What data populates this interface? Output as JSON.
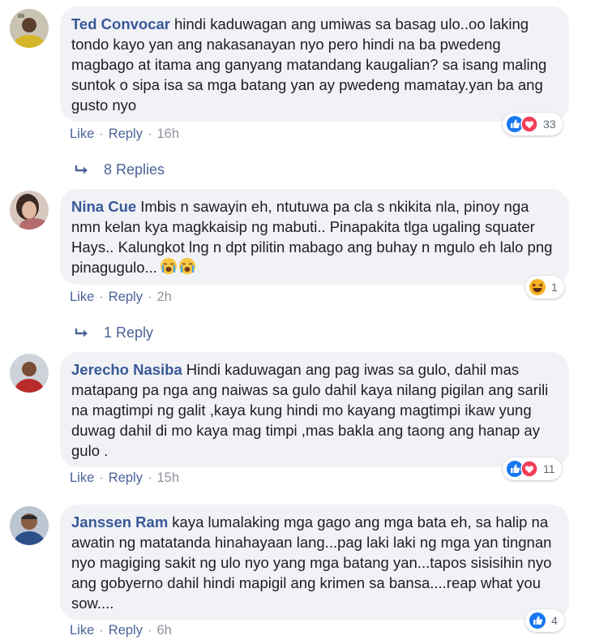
{
  "ui": {
    "like": "Like",
    "reply": "Reply",
    "dot": "·"
  },
  "comments": [
    {
      "author": "Ted Convocar",
      "text": "hindi kaduwagan ang umiwas sa basag ulo..oo laking tondo kayo yan ang nakasanayan nyo pero hindi na ba pwedeng magbago at itama ang ganyang matandang kaugalian? sa isang maling suntok o sipa isa sa mga batang yan ay pwedeng mamatay.yan ba ang gusto nyo",
      "time": "16h",
      "reaction_icons": [
        "like-reaction-icon",
        "love-reaction-icon"
      ],
      "reaction_count": "33",
      "replies": "8 Replies"
    },
    {
      "author": "Nina Cue",
      "text": "Imbis n sawayin eh, ntutuwa pa cla s nkikita nla, pinoy nga nmn kelan kya magkkaisip ng mabuti.. Pinapakita tlga ugaling squater Hays.. Kalungkot lng n dpt pilitin mabago ang buhay n mgulo eh lalo png pinagugulo...",
      "time": "2h",
      "reaction_icons": [
        "haha-reaction-icon"
      ],
      "reaction_count": "1",
      "replies": "1 Reply"
    },
    {
      "author": "Jerecho Nasiba",
      "text": "Hindi kaduwagan ang pag iwas sa gulo, dahil mas matapang pa nga ang naiwas sa gulo dahil kaya nilang pigilan ang sarili na magtimpi ng galit ,kaya kung hindi mo kayang magtimpi ikaw yung duwag dahil di mo kaya mag timpi ,mas bakla ang taong ang hanap ay gulo .",
      "time": "15h",
      "reaction_icons": [
        "like-reaction-icon",
        "love-reaction-icon"
      ],
      "reaction_count": "11"
    },
    {
      "author": "Janssen Ram",
      "text": "kaya lumalaking mga gago ang mga bata eh, sa halip na awatin ng matatanda hinahayaan lang...pag laki laki ng mga yan tingnan nyo magiging sakit ng ulo nyo yang mga batang yan...tapos sisisihin nyo ang gobyerno dahil hindi mapigil ang krimen sa bansa....reap what you sow....",
      "time": "6h",
      "reaction_icons": [
        "like-reaction-icon"
      ],
      "reaction_count": "4"
    }
  ]
}
